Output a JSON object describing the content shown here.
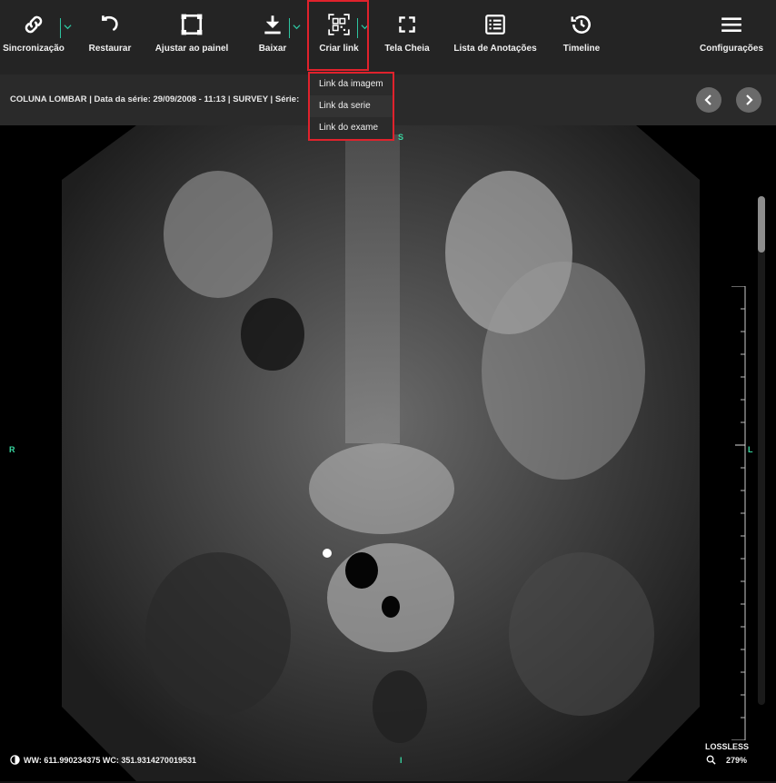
{
  "toolbar": {
    "sync_label": "Sincronização",
    "restore_label": "Restaurar",
    "fit_label": "Ajustar ao painel",
    "download_label": "Baixar",
    "create_link_label": "Criar link",
    "fullscreen_label": "Tela Cheia",
    "annotations_label": "Lista de Anotações",
    "timeline_label": "Timeline",
    "settings_label": "Configurações"
  },
  "link_menu": {
    "items": [
      "Link da imagem",
      "Link da serie",
      "Link do exame"
    ]
  },
  "series": {
    "info": "COLUNA LOMBAR  |  Data da série: 29/09/2008 - 11:13  |  SURVEY  |  Série:"
  },
  "orientation": {
    "top": "S",
    "left": "R",
    "right": "L",
    "bottom": "I"
  },
  "overlay": {
    "window": "WW: 611.990234375 WC: 351.9314270019531",
    "compression": "LOSSLESS",
    "zoom": "279%"
  },
  "colors": {
    "accent": "#2ec4a0",
    "highlight": "#e0222c",
    "orientation": "#39d9a2"
  }
}
